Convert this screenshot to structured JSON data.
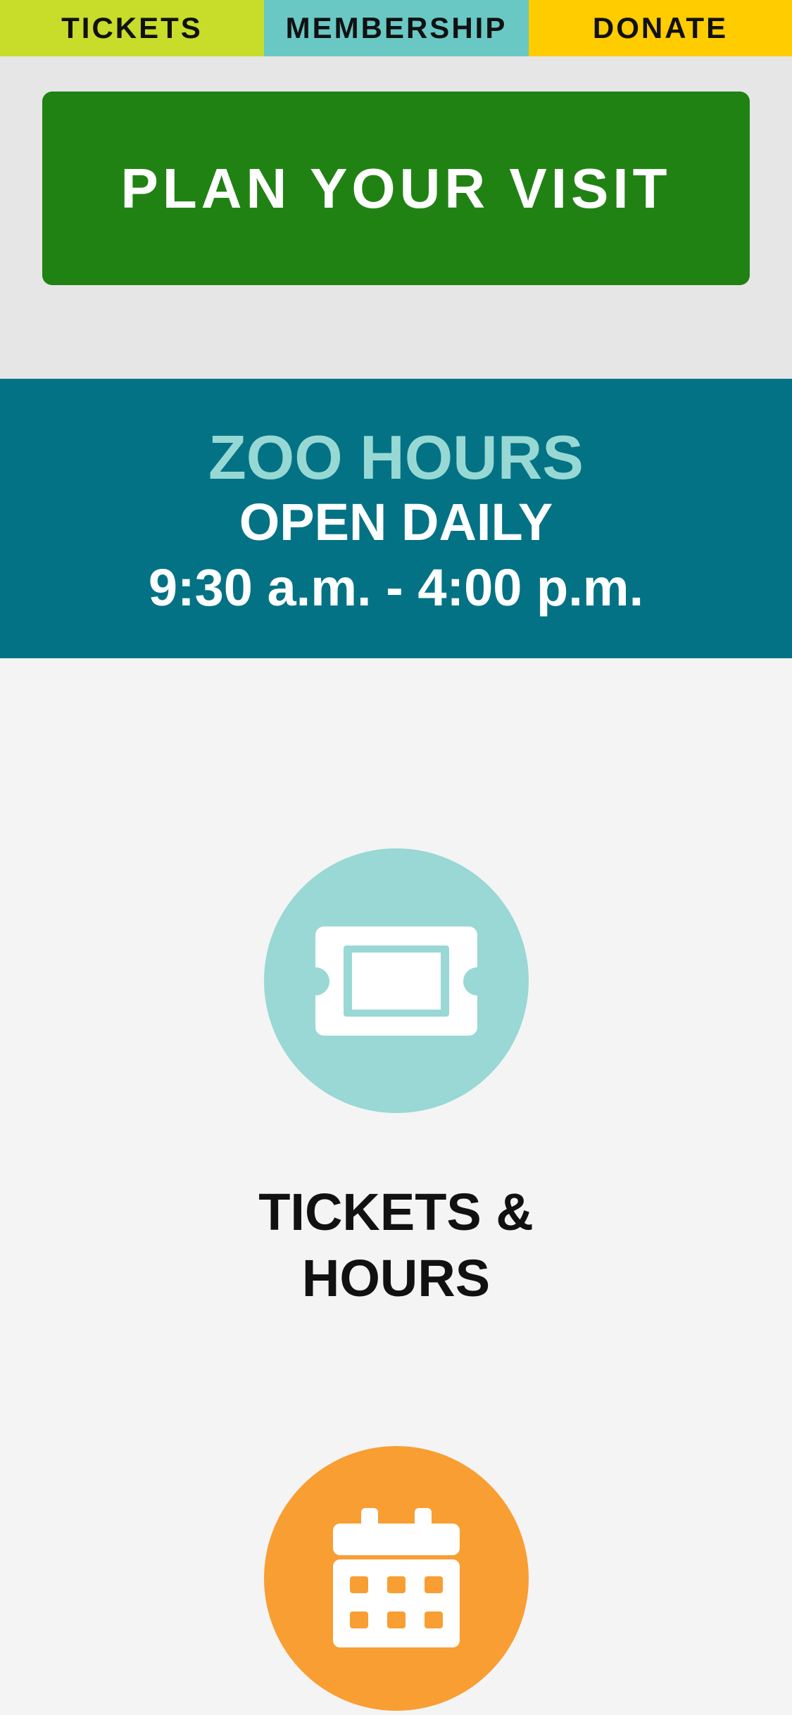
{
  "top_tabs": [
    {
      "label": "TICKETS",
      "color": "#c8dc2a"
    },
    {
      "label": "MEMBERSHIP",
      "color": "#69c8c4"
    },
    {
      "label": "DONATE",
      "color": "#ffcc00"
    }
  ],
  "plan": {
    "label": "PLAN YOUR VISIT",
    "color": "#218214"
  },
  "hours": {
    "title": "ZOO HOURS",
    "subtitle": "OPEN DAILY",
    "time": "9:30 a.m. - 4:00 p.m.",
    "background": "#037285",
    "title_color": "#98d8d4"
  },
  "tickets_item": {
    "label": "TICKETS & HOURS",
    "icon": "ticket-icon",
    "icon_bg": "#99d8d4"
  },
  "calendar_item": {
    "icon": "calendar-icon",
    "icon_bg": "#f89e33"
  }
}
